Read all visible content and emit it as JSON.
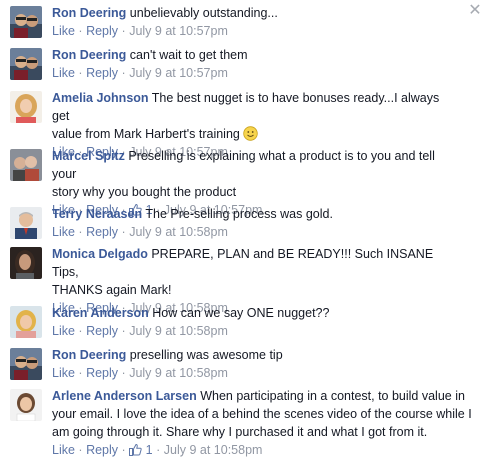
{
  "comments": [
    {
      "author": "Ron Deering",
      "text": "unbelievably outstanding...",
      "like": "Like",
      "reply": "Reply",
      "time": "July 9 at 10:57pm",
      "likes": ""
    },
    {
      "author": "Ron Deering",
      "text": "can't wait to get them",
      "like": "Like",
      "reply": "Reply",
      "time": "July 9 at 10:57pm",
      "likes": ""
    },
    {
      "author": "Amelia Johnson",
      "text_line1": "The best nugget is to have bonuses ready...I always get",
      "text_line2": "value from Mark Harbert's training",
      "like": "Like",
      "reply": "Reply",
      "time": "July 9 at 10:57pm",
      "likes": ""
    },
    {
      "author": "Marcel Spitz",
      "text_line1": "Preselling is explaining what a product is to you and tell your",
      "text_line2": "story why you bought the product",
      "like": "Like",
      "reply": "Reply",
      "time": "July 9 at 10:57pm",
      "likes": "1"
    },
    {
      "author": "Terry Neraasen",
      "text": "The Pre-selling process was gold.",
      "like": "Like",
      "reply": "Reply",
      "time": "July 9 at 10:58pm",
      "likes": ""
    },
    {
      "author": "Monica Delgado",
      "text_line1": "PREPARE, PLAN and BE READY!!! Such INSANE Tips,",
      "text_line2": "THANKS again Mark!",
      "like": "Like",
      "reply": "Reply",
      "time": "July 9 at 10:58pm",
      "likes": ""
    },
    {
      "author": "Karen Anderson",
      "text": "How can we say ONE nugget??",
      "like": "Like",
      "reply": "Reply",
      "time": "July 9 at 10:58pm",
      "likes": ""
    },
    {
      "author": "Ron Deering",
      "text": "preselling was awesome tip",
      "like": "Like",
      "reply": "Reply",
      "time": "July 9 at 10:58pm",
      "likes": ""
    },
    {
      "author": "Arlene Anderson Larsen",
      "text_line1": "When participating in a contest, to build value in",
      "text_line2": "your email. I love the idea of a behind the scenes video of the course while I",
      "text_line3": "am going through it. Share why I purchased it and what I got from it.",
      "like": "Like",
      "reply": "Reply",
      "time": "July 9 at 10:58pm",
      "likes": "1"
    }
  ],
  "separator": "·",
  "icons": {
    "close": "close-icon",
    "like_count": "thumbs-up-icon",
    "emoji": "smiley-emoji-icon"
  },
  "colors": {
    "author": "#3b5998",
    "link": "#5f77a8",
    "meta": "#9197a3",
    "text": "#141823"
  }
}
